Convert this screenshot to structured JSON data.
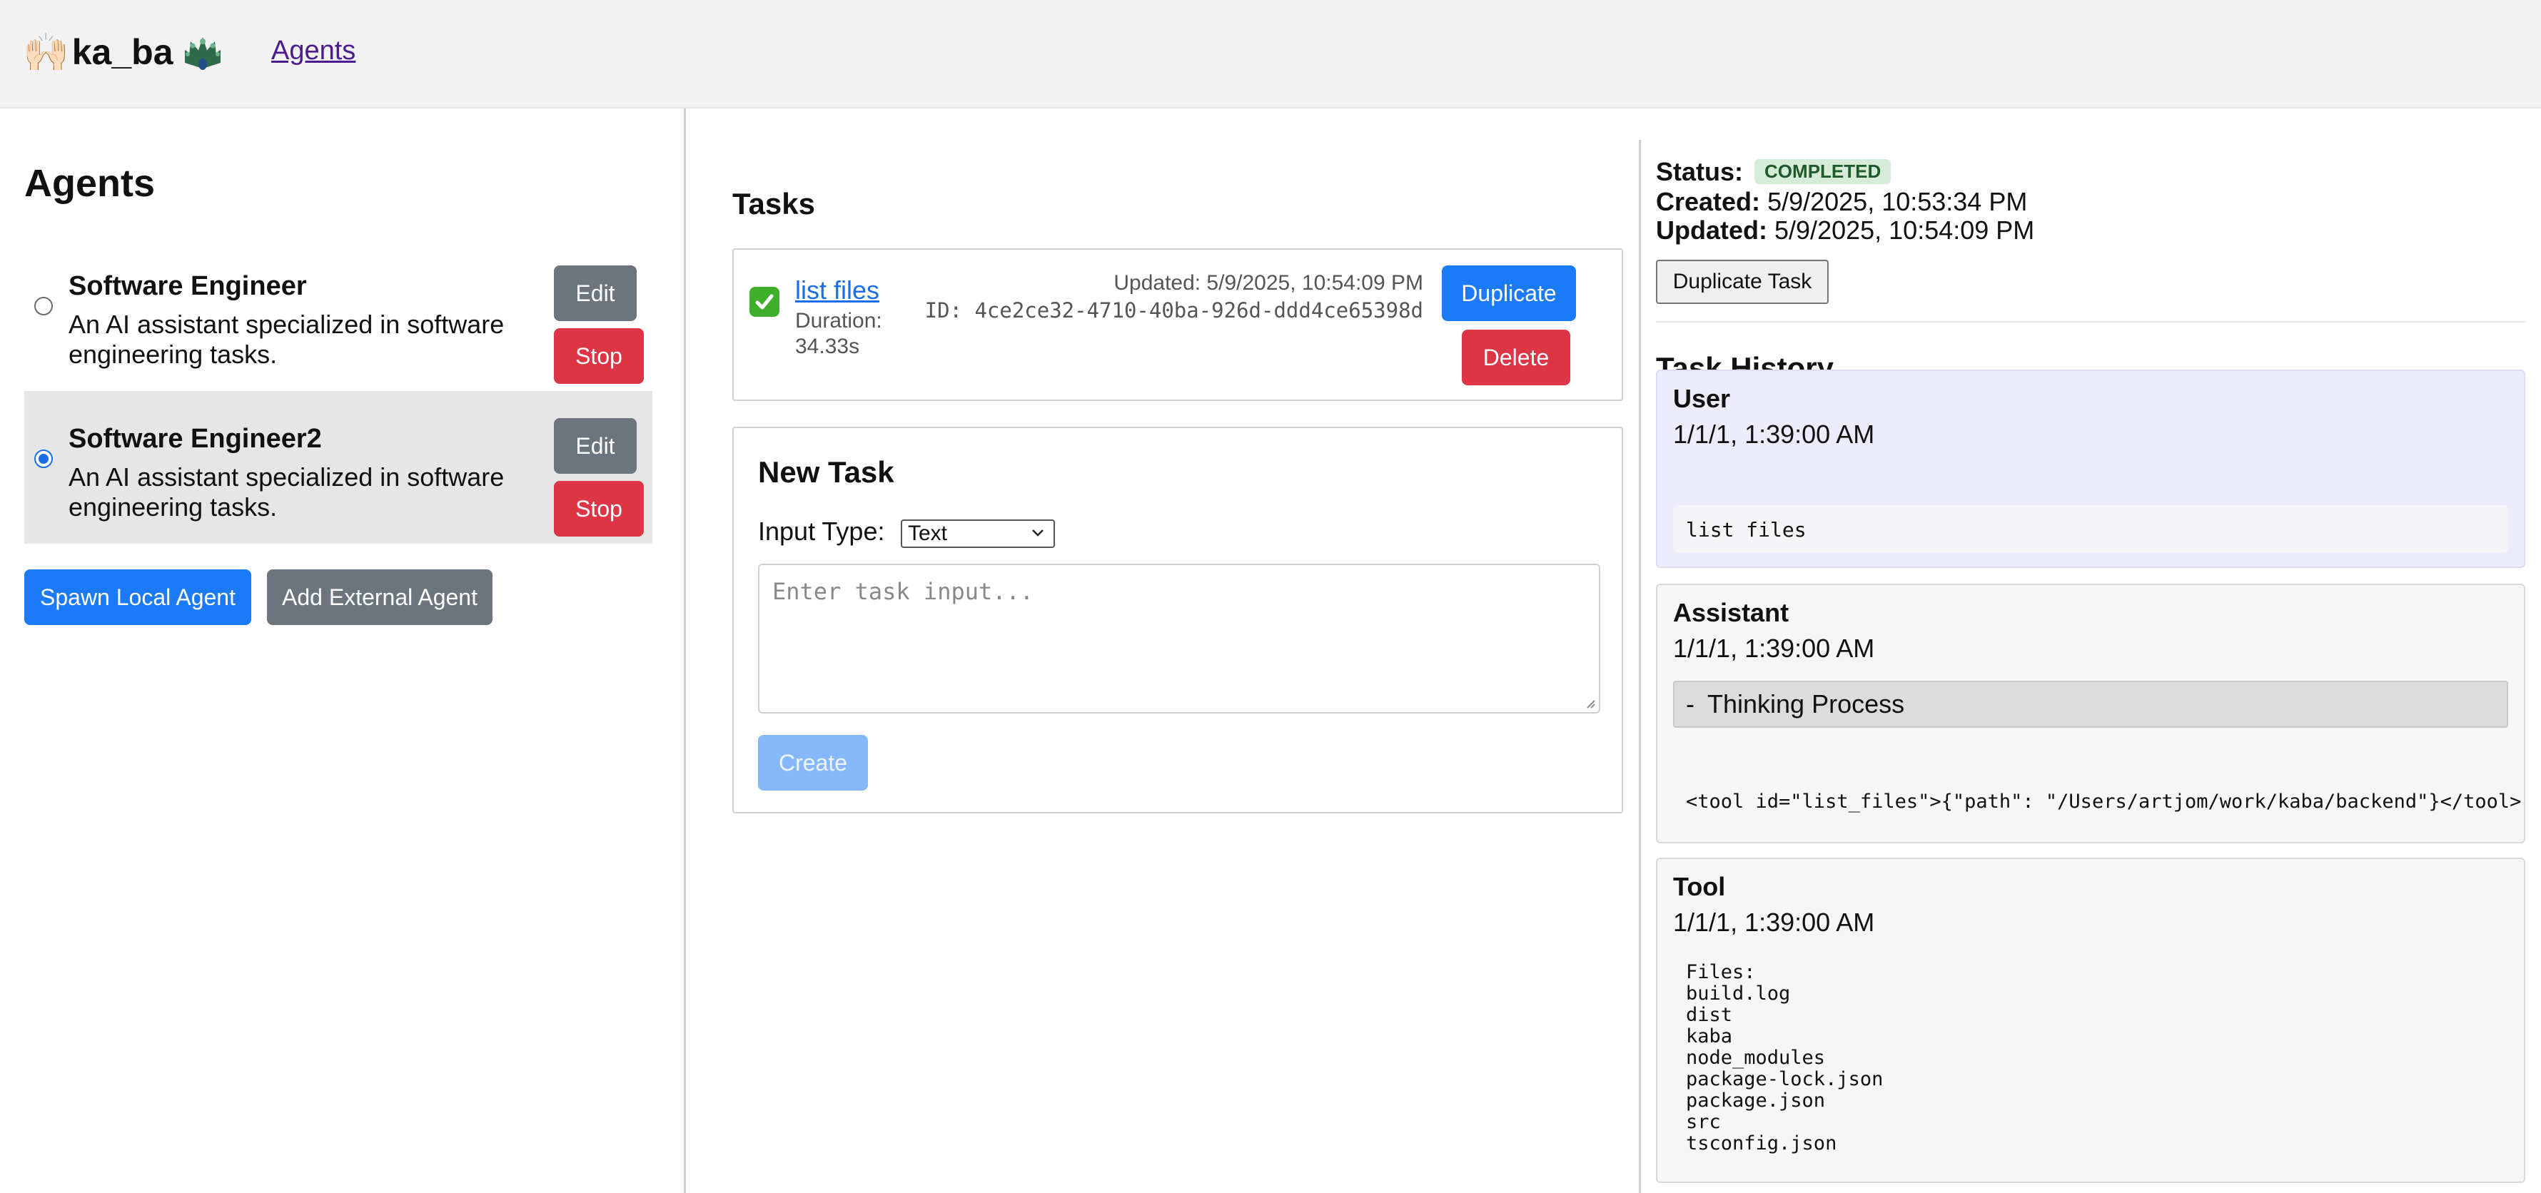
{
  "header": {
    "brand_left_emoji": "🙌🏻",
    "brand_text": "ka_ba",
    "nav_agents": "Agents"
  },
  "agents": {
    "title": "Agents",
    "items": [
      {
        "name": "Software Engineer",
        "description": "An AI assistant specialized in software engineering tasks.",
        "selected": false,
        "edit_label": "Edit",
        "stop_label": "Stop"
      },
      {
        "name": "Software Engineer2",
        "description": "An AI assistant specialized in software engineering tasks.",
        "selected": true,
        "edit_label": "Edit",
        "stop_label": "Stop"
      }
    ],
    "spawn_label": "Spawn Local Agent",
    "add_external_label": "Add External Agent"
  },
  "tasks": {
    "title": "Tasks",
    "list": [
      {
        "name": "list files",
        "duration_label": "Duration:",
        "duration_value": "34.33s",
        "updated": "Updated: 5/9/2025, 10:54:09 PM",
        "id_text": "ID: 4ce2ce32-4710-40ba-926d-ddd4ce65398d",
        "duplicate_label": "Duplicate",
        "delete_label": "Delete"
      }
    ],
    "new_task": {
      "title": "New Task",
      "input_type_label": "Input Type:",
      "input_type_value": "Text",
      "textarea_placeholder": "Enter task input...",
      "create_label": "Create"
    }
  },
  "detail": {
    "status_label": "Status:",
    "status_value": "COMPLETED",
    "created_label": "Created:",
    "created_value": "5/9/2025, 10:53:34 PM",
    "updated_label": "Updated:",
    "updated_value": "5/9/2025, 10:54:09 PM",
    "duplicate_task_label": "Duplicate Task",
    "history_title": "Task History",
    "history": {
      "user": {
        "role": "User",
        "time": "1/1/1, 1:39:00 AM",
        "content": "list files"
      },
      "assistant": {
        "role": "Assistant",
        "time": "1/1/1, 1:39:00 AM",
        "thinking_toggle": "-",
        "thinking_label": "Thinking Process",
        "tool_call": "<tool id=\"list_files\">{\"path\": \"/Users/artjom/work/kaba/backend\"}</tool>"
      },
      "tool": {
        "role": "Tool",
        "time": "1/1/1, 1:39:00 AM",
        "output": "Files:\nbuild.log\ndist\nkaba\nnode_modules\npackage-lock.json\npackage.json\nsrc\ntsconfig.json"
      }
    }
  },
  "colors": {
    "primary": "#1a7af8",
    "danger": "#dc3545",
    "secondary": "#6c757d",
    "success_badge_bg": "#d6ecd9",
    "success_badge_text": "#1e5a2a"
  }
}
